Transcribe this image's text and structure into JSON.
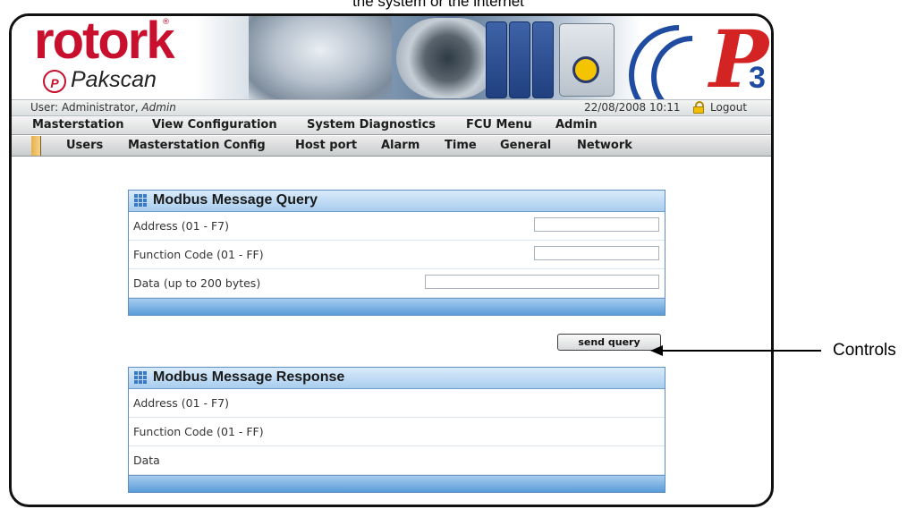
{
  "caption": {
    "top": "the system or the internet"
  },
  "brand": {
    "logo": "rotork",
    "product": "Pakscan",
    "badge_letter": "P",
    "mark": "P",
    "mark_sub": "3"
  },
  "status": {
    "user_prefix": "User: Administrator, ",
    "user_role": "Admin",
    "datetime": "22/08/2008 10:11",
    "logout": "Logout"
  },
  "menu": {
    "main": [
      "Masterstation",
      "View Configuration",
      "System Diagnostics",
      "FCU Menu",
      "Admin"
    ],
    "sub": [
      "Users",
      "Masterstation Config",
      "Host port",
      "Alarm",
      "Time",
      "General",
      "Network"
    ]
  },
  "query": {
    "title": "Modbus Message Query",
    "rows": [
      {
        "label": "Address (01 - F7)",
        "value": ""
      },
      {
        "label": "Function Code (01 - FF)",
        "value": ""
      },
      {
        "label": "Data (up to 200 bytes)",
        "value": ""
      }
    ]
  },
  "send_button": "send query",
  "response": {
    "title": "Modbus Message Response",
    "rows": [
      {
        "label": "Address (01 - F7)"
      },
      {
        "label": "Function Code (01 - FF)"
      },
      {
        "label": "Data"
      }
    ]
  },
  "callout": {
    "text": "Controls"
  },
  "icons": {
    "registered": "registered-mark-icon",
    "lock": "lock-icon",
    "panel": "grid-icon",
    "arrow": "arrow-left-icon"
  },
  "colors": {
    "brand_red": "#c8102e",
    "brand_blue": "#1f4ba0",
    "panel_blue": "#5b9bd8",
    "menu_accent": "#e8b04a"
  }
}
